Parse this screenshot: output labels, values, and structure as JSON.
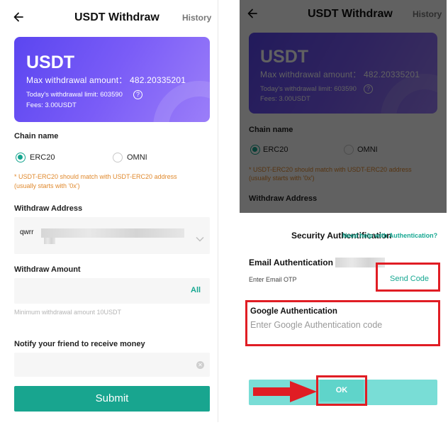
{
  "header": {
    "title": "USDT Withdraw",
    "history": "History"
  },
  "card": {
    "coin": "USDT",
    "max_withdrawal": "Max withdrawal amount： 482.20335201",
    "daily_limit": "Today's withdrawal limit: 603590",
    "fees": "Fees: 3.00USDT",
    "help_glyph": "?"
  },
  "chain": {
    "label": "Chain name",
    "options": [
      {
        "label": "ERC20",
        "selected": true
      },
      {
        "label": "OMNI",
        "selected": false
      }
    ],
    "warning_line1": "* USDT-ERC20 should match with USDT-ERC20 address",
    "warning_line2": "(usually starts with '0x')"
  },
  "address": {
    "label": "Withdraw Address",
    "value_prefix": "qwrr"
  },
  "amount": {
    "label": "Withdraw Amount",
    "all_label": "All",
    "hint": "Minimum withdrawal amount 10USDT"
  },
  "notify": {
    "label": "Notify your friend to receive money",
    "clear_glyph": "✕"
  },
  "submit_label": "Submit",
  "security": {
    "title": "Security Authentification",
    "help_link": "Need help with Authentication?",
    "email_label": "Email Authentication",
    "email_placeholder": "Enter Email OTP",
    "send_code": "Send Code",
    "google_label": "Google Authentication",
    "google_placeholder": "Enter Google Authentication code",
    "ok_label": "OK"
  },
  "icons": {
    "back": "arrow-left-icon",
    "help": "question-circle-icon",
    "chevron": "chevron-down-icon",
    "clear": "clear-circle-icon",
    "pointer": "red-arrow-icon"
  },
  "colors": {
    "accent": "#18a58f",
    "card_gradient_start": "#5b46f0",
    "card_gradient_end": "#9b7ef9",
    "warning": "#e0892d",
    "highlight": "#e01d24",
    "ok_disabled": "#79ddd6"
  }
}
